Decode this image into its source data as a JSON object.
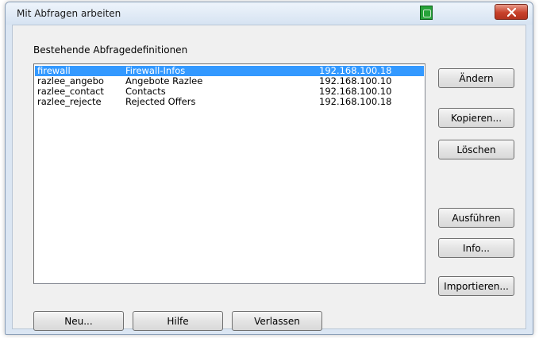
{
  "window": {
    "title": "Mit Abfragen arbeiten"
  },
  "group_label": "Bestehende Abfragedefinitionen",
  "list": {
    "rows": [
      {
        "name": "firewall",
        "description": "Firewall-Infos",
        "ip": "192.168.100.18",
        "selected": true
      },
      {
        "name": "razlee_angebo",
        "description": "Angebote Razlee",
        "ip": "192.168.100.10",
        "selected": false
      },
      {
        "name": "razlee_contact",
        "description": "Contacts",
        "ip": "192.168.100.10",
        "selected": false
      },
      {
        "name": "razlee_rejecte",
        "description": "Rejected Offers",
        "ip": "192.168.100.18",
        "selected": false
      }
    ]
  },
  "buttons": {
    "change": "Ändern",
    "copy": "Kopieren...",
    "delete": "Löschen",
    "run": "Ausführen",
    "info": "Info...",
    "import": "Importieren...",
    "new": "Neu...",
    "help": "Hilfe",
    "exit": "Verlassen"
  },
  "colors": {
    "selection": "#3399ff",
    "close_button": "#c8412b",
    "title_icon": "#27a33a"
  },
  "icons": {
    "title_icon": "app-icon",
    "close": "close-icon"
  }
}
